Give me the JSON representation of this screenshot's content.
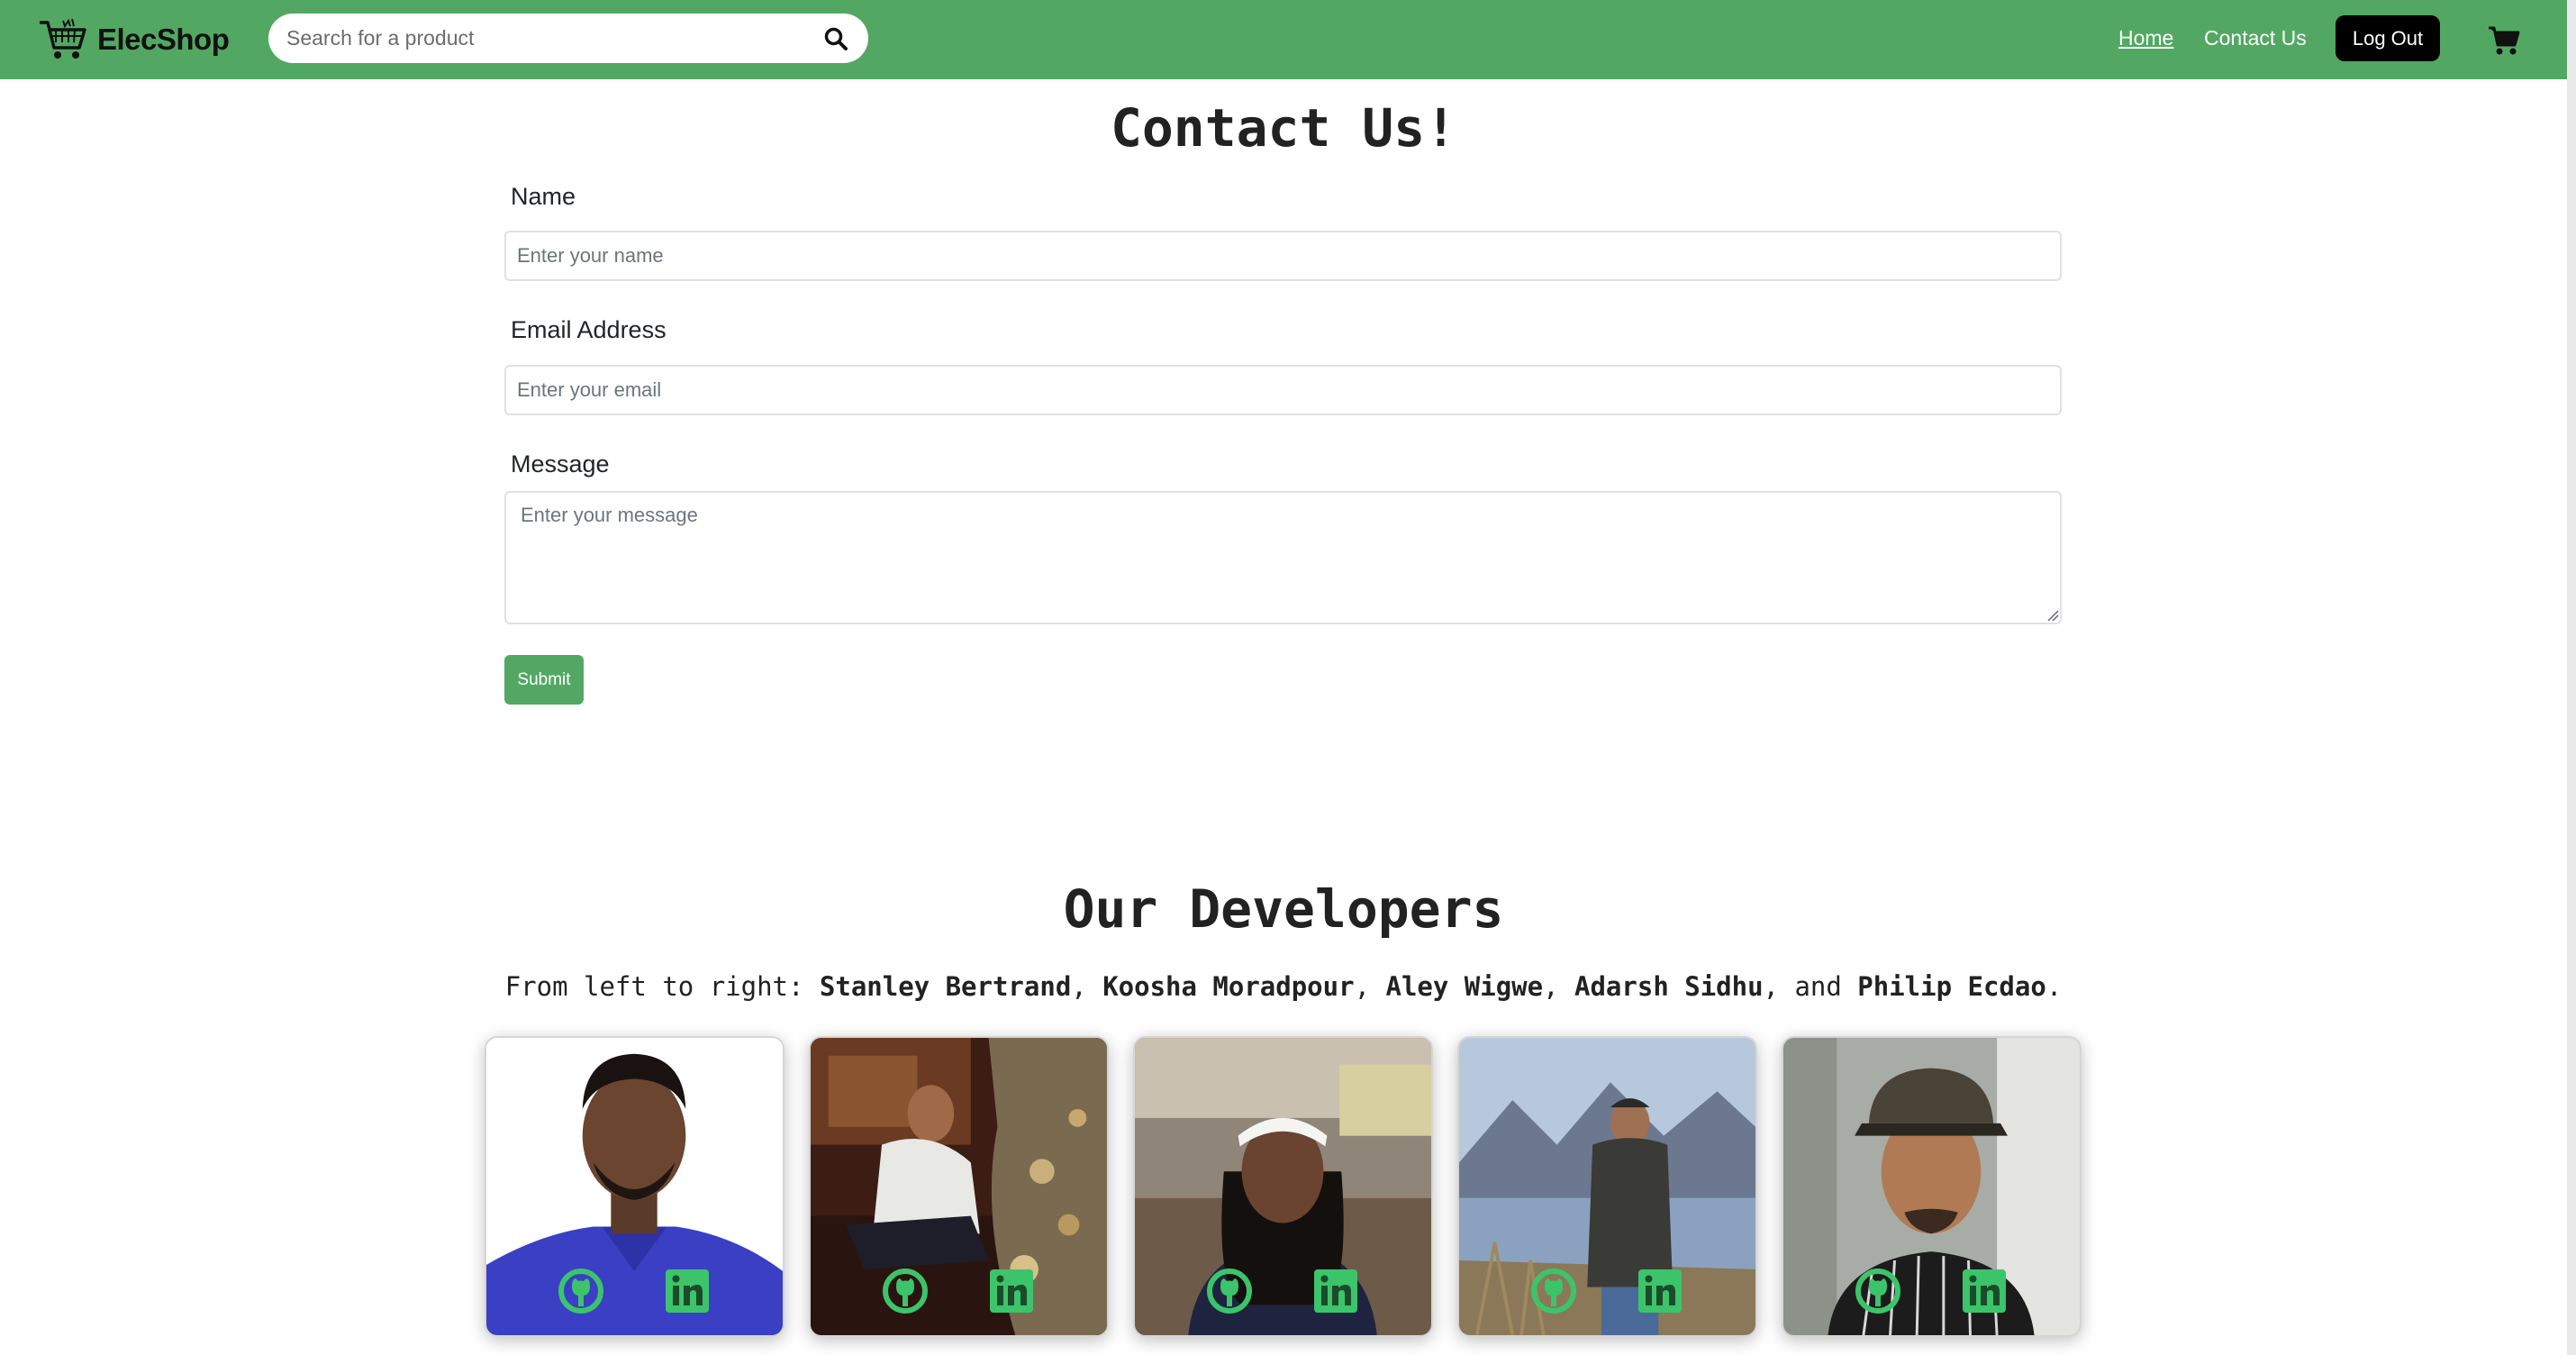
{
  "navbar": {
    "brand": "ElecShop",
    "search_placeholder": "Search for a product",
    "links": {
      "home": "Home",
      "contact": "Contact Us"
    },
    "logout_label": "Log Out",
    "bg_color": "#52a862"
  },
  "contact": {
    "title": "Contact Us!",
    "name_label": "Name",
    "name_placeholder": "Enter your name",
    "email_label": "Email Address",
    "email_placeholder": "Enter your email",
    "message_label": "Message",
    "message_placeholder": "Enter your message",
    "submit_label": "Submit"
  },
  "developers": {
    "title": "Our Developers",
    "intro_prefix": "From left to right: ",
    "names": [
      "Stanley Bertrand",
      "Koosha Moradpour",
      "Aley Wigwe",
      "Adarsh Sidhu",
      "Philip Ecdao"
    ],
    "sep": ", ",
    "and": ", and ",
    "end": ".",
    "icons": [
      "github-icon",
      "linkedin-icon"
    ],
    "icon_color": "#3cc46a"
  }
}
